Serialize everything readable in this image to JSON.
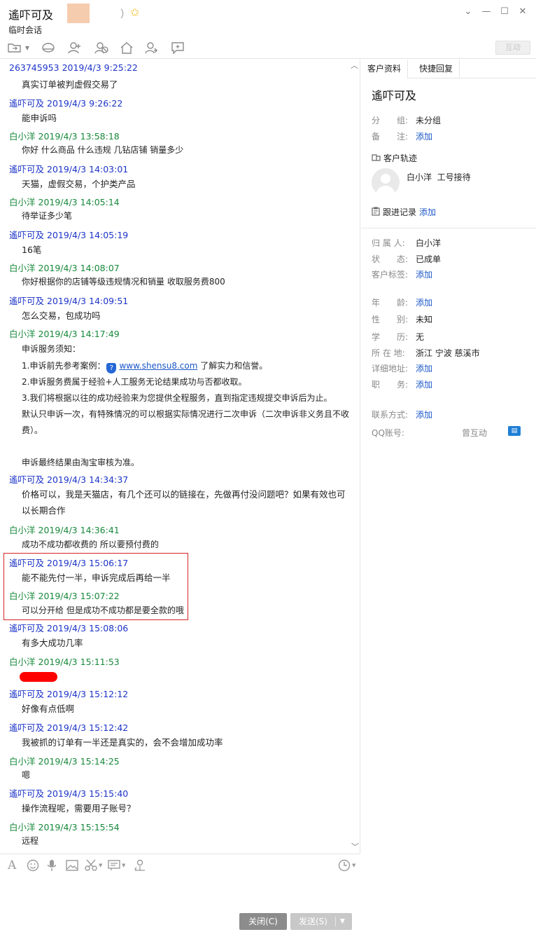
{
  "window": {
    "title": "遙吓可及",
    "title_paren": "）",
    "subtitle": "临时会话",
    "controls": [
      "chevron-down-icon",
      "minimize-icon",
      "maximize-icon",
      "close-icon"
    ]
  },
  "toolbar": {
    "icons": [
      "folder-icon",
      "hat-icon",
      "add-user-icon",
      "block-user-icon",
      "home-icon",
      "transfer-user-icon",
      "feedback-icon"
    ],
    "right_button": "互动"
  },
  "messages": [
    {
      "sender": "263745953",
      "time": "2019/4/3 9:25:22",
      "color": "blue",
      "text": "真实订单被判虚假交易了"
    },
    {
      "sender": "遙吓可及",
      "time": "2019/4/3 9:26:22",
      "color": "blue",
      "text": "能申诉吗"
    },
    {
      "sender": "白小洋",
      "time": "2019/4/3 13:58:18",
      "color": "green",
      "text": "你好 什么商品 什么违规  几钻店铺 销量多少"
    },
    {
      "sender": "遙吓可及",
      "time": "2019/4/3 14:03:01",
      "color": "blue",
      "text": "天猫，虚假交易，个护类产品"
    },
    {
      "sender": "白小洋",
      "time": "2019/4/3 14:05:14",
      "color": "green",
      "text": "待举证多少笔"
    },
    {
      "sender": "遙吓可及",
      "time": "2019/4/3 14:05:19",
      "color": "blue",
      "text": "16笔"
    },
    {
      "sender": "白小洋",
      "time": "2019/4/3 14:08:07",
      "color": "green",
      "text": "你好根据你的店铺等级违规情况和销量 收取服务费800"
    },
    {
      "sender": "遙吓可及",
      "time": "2019/4/3 14:09:51",
      "color": "blue",
      "text": "怎么交易，包成功吗"
    },
    {
      "sender": "白小洋",
      "time": "2019/4/3 14:17:49",
      "color": "green",
      "text": ""
    },
    {
      "sender": "遙吓可及",
      "time": "2019/4/3 14:34:37",
      "color": "blue",
      "text": "价格可以，我是天猫店，有几个还可以的链接在，先做再付没问题吧？如果有效也可以长期合作"
    },
    {
      "sender": "白小洋",
      "time": "2019/4/3 14:36:41",
      "color": "green",
      "text": "成功不成功都收费的 所以要预付费的"
    },
    {
      "sender": "遙吓可及",
      "time": "2019/4/3 15:06:17",
      "color": "blue",
      "text": "能不能先付一半，申诉完成后再给一半"
    },
    {
      "sender": "白小洋",
      "time": "2019/4/3 15:07:22",
      "color": "green",
      "text": "可以分开给 但是成功不成功都是要全款的哦"
    },
    {
      "sender": "遙吓可及",
      "time": "2019/4/3 15:08:06",
      "color": "blue",
      "text": "有多大成功几率"
    },
    {
      "sender": "白小洋",
      "time": "2019/4/3 15:11:53",
      "color": "green",
      "text": ""
    },
    {
      "sender": "遙吓可及",
      "time": "2019/4/3 15:12:12",
      "color": "blue",
      "text": "好像有点低啊"
    },
    {
      "sender": "遙吓可及",
      "time": "2019/4/3 15:12:42",
      "color": "blue",
      "text": "我被抓的订单有一半还是真实的，会不会增加成功率"
    },
    {
      "sender": "白小洋",
      "time": "2019/4/3 15:14:25",
      "color": "green",
      "text": "嗯"
    },
    {
      "sender": "遙吓可及",
      "time": "2019/4/3 15:15:40",
      "color": "blue",
      "text": "操作流程呢，需要用子账号？"
    },
    {
      "sender": "白小洋",
      "time": "2019/4/3 15:15:54",
      "color": "green",
      "text": "远程"
    }
  ],
  "notice": {
    "title": "申诉服务须知：",
    "line1_prefix": "1.申诉前先参考案例：",
    "link": "www.shensu8.com",
    "line1_suffix": " 了解实力和信誉。",
    "line2": "2.申诉服务费属于经验+人工服务无论结果成功与否都收取。",
    "line3": "3.我们将根据以往的成功经验来为您提供全程服务，直到指定违规提交申诉后为止。",
    "line4a": "默认只申诉一次，有特殊情况的可以根据实际情况进行二次申诉（二次申诉非义务且不收",
    "line4b": "费）。",
    "line5": "申诉最终结果由淘宝审核为准。"
  },
  "input_toolbar": {
    "icons": [
      "font-icon",
      "emoji-icon",
      "mic-icon",
      "image-icon",
      "scissors-icon",
      "quick-phrase-icon",
      "transfer-icon",
      "history-icon"
    ]
  },
  "buttons": {
    "close": "关闭(C)",
    "send": "发送(S)"
  },
  "right_panel": {
    "tabs": [
      "客户资料",
      "快捷回复"
    ],
    "customer_name": "遙吓可及",
    "group_label": "分　　组:",
    "group_value": "未分组",
    "note_label": "备　　注:",
    "note_add": "添加",
    "trace_title": "客户轨迹",
    "agent": "白小洋",
    "agent_role": "工号接待",
    "followup_title": "跟进记录",
    "followup_add": "添加",
    "owner_label": "归 属 人:",
    "owner_value": "白小洋",
    "status_label": "状　　态:",
    "status_value": "已成单",
    "tags_label": "客户标签:",
    "tags_add": "添加",
    "age_label": "年　　龄:",
    "age_add": "添加",
    "gender_label": "性　　别:",
    "gender_value": "未知",
    "edu_label": "学　　历:",
    "edu_value": "无",
    "location_label": "所 在 地:",
    "location_value": "浙江 宁波 慈溪市",
    "address_label": "详细地址:",
    "address_add": "添加",
    "job_label": "职　　务:",
    "job_add": "添加",
    "contact_label": "联系方式:",
    "contact_add": "添加",
    "qq_label": "QQ账号:",
    "qq_value": "曾互动"
  }
}
